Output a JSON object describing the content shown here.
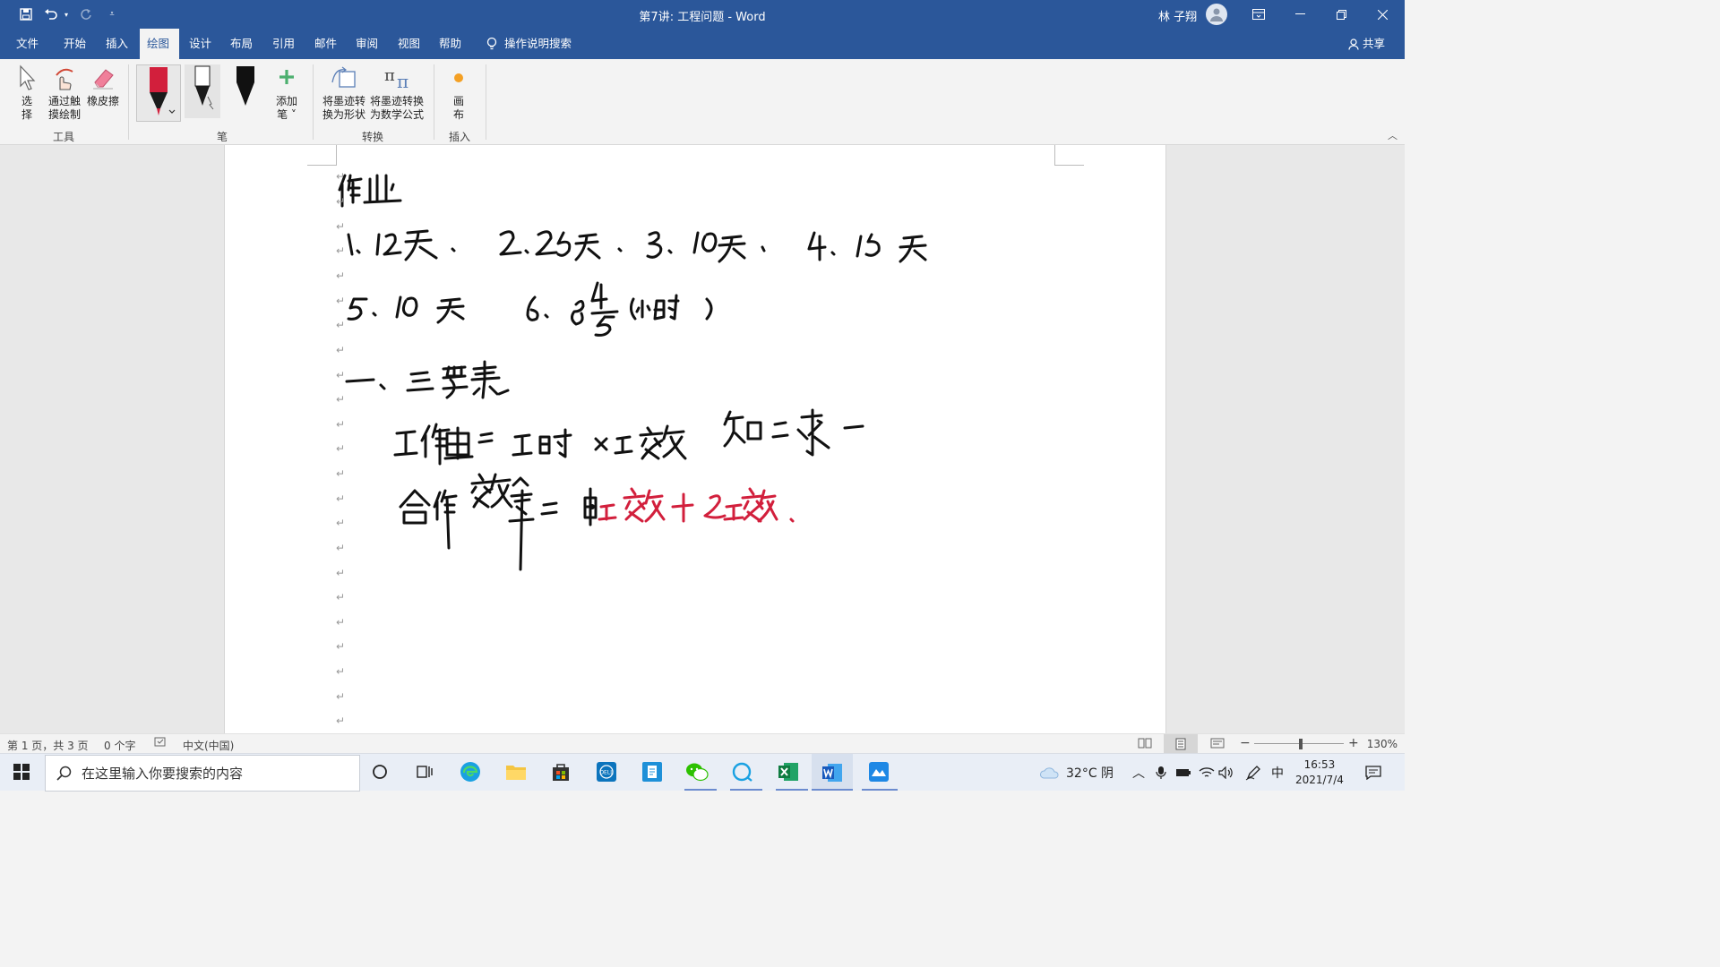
{
  "window": {
    "title": "第7讲: 工程问题 - Word",
    "user_name": "林 子翔"
  },
  "menu": {
    "tabs": [
      "文件",
      "开始",
      "插入",
      "绘图",
      "设计",
      "布局",
      "引用",
      "邮件",
      "审阅",
      "视图",
      "帮助"
    ],
    "active_tab": "绘图",
    "tell_me": "操作说明搜索",
    "share": "共享"
  },
  "ribbon": {
    "tools": {
      "select_line1": "选",
      "select_line2": "择",
      "touch_draw_line1": "通过触",
      "touch_draw_line2": "摸绘制",
      "eraser": "橡皮擦",
      "group_label": "工具"
    },
    "pens": {
      "add_pen_line1": "添加",
      "add_pen_line2": "笔 ˅",
      "group_label": "笔"
    },
    "convert": {
      "ink_to_shape_line1": "将墨迹转",
      "ink_to_shape_line2": "换为形状",
      "ink_to_math_line1": "将墨迹转换",
      "ink_to_math_line2": "为数学公式",
      "group_label": "转换"
    },
    "insert": {
      "canvas_line1": "画",
      "canvas_line2": "布",
      "group_label": "插入"
    }
  },
  "document": {
    "ink_lines": [
      "作业",
      "1.12天、  2.25天、  3.10天、  4.15天",
      "5.10天    6.8⁴⁄₅(小时)",
      "一、三要素",
      "工作量=工时×工效   知二求一",
      "合作效率=",
      "甲工效+乙工效."
    ]
  },
  "status": {
    "page": "第 1 页，共 3 页",
    "words": "0 个字",
    "language": "中文(中国)",
    "zoom": "130%"
  },
  "taskbar": {
    "search_placeholder": "在这里输入你要搜索的内容",
    "weather": "32°C 阴",
    "ime": "中",
    "time": "16:53",
    "date": "2021/7/4"
  },
  "colors": {
    "word_blue": "#2b579a",
    "ink_black": "#111111",
    "ink_red": "#d21f3c"
  }
}
